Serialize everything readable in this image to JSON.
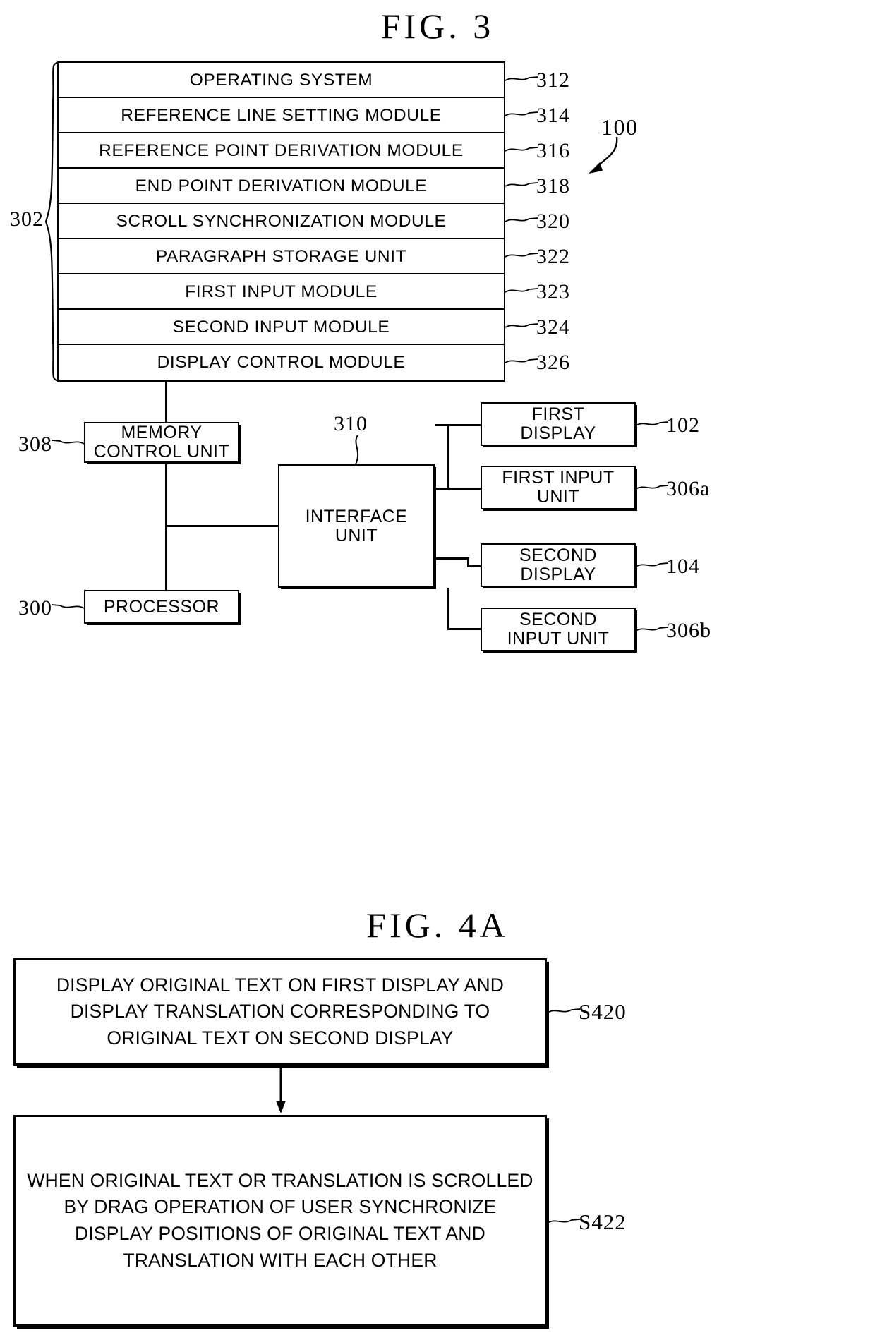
{
  "figures": {
    "fig3": {
      "title": "FIG.  3",
      "group_label": "302",
      "device_label": "100",
      "modules": [
        {
          "label": "OPERATING SYSTEM",
          "ref": "312"
        },
        {
          "label": "REFERENCE LINE SETTING MODULE",
          "ref": "314"
        },
        {
          "label": "REFERENCE POINT DERIVATION MODULE",
          "ref": "316"
        },
        {
          "label": "END POINT DERIVATION MODULE",
          "ref": "318"
        },
        {
          "label": "SCROLL SYNCHRONIZATION MODULE",
          "ref": "320"
        },
        {
          "label": "PARAGRAPH STORAGE UNIT",
          "ref": "322"
        },
        {
          "label": "FIRST INPUT MODULE",
          "ref": "323"
        },
        {
          "label": "SECOND INPUT MODULE",
          "ref": "324"
        },
        {
          "label": "DISPLAY CONTROL MODULE",
          "ref": "326"
        }
      ],
      "blocks": {
        "memory_control_unit": {
          "line1": "MEMORY",
          "line2": "CONTROL UNIT",
          "ref": "308"
        },
        "processor": {
          "label": "PROCESSOR",
          "ref": "300"
        },
        "interface_unit": {
          "line1": "INTERFACE",
          "line2": "UNIT",
          "ref": "310"
        },
        "first_display": {
          "line1": "FIRST",
          "line2": "DISPLAY",
          "ref": "102"
        },
        "first_input_unit": {
          "line1": "FIRST INPUT",
          "line2": "UNIT",
          "ref": "306a"
        },
        "second_display": {
          "line1": "SECOND",
          "line2": "DISPLAY",
          "ref": "104"
        },
        "second_input_unit": {
          "line1": "SECOND",
          "line2": "INPUT UNIT",
          "ref": "306b"
        }
      }
    },
    "fig4a": {
      "title": "FIG.  4A",
      "steps": [
        {
          "text": "DISPLAY ORIGINAL TEXT ON FIRST DISPLAY AND DISPLAY TRANSLATION CORRESPONDING TO ORIGINAL TEXT ON SECOND DISPLAY",
          "ref": "S420"
        },
        {
          "text": "WHEN ORIGINAL TEXT OR TRANSLATION IS SCROLLED BY DRAG OPERATION OF USER SYNCHRONIZE DISPLAY POSITIONS OF ORIGINAL TEXT AND TRANSLATION WITH EACH OTHER",
          "ref": "S422"
        }
      ]
    }
  }
}
